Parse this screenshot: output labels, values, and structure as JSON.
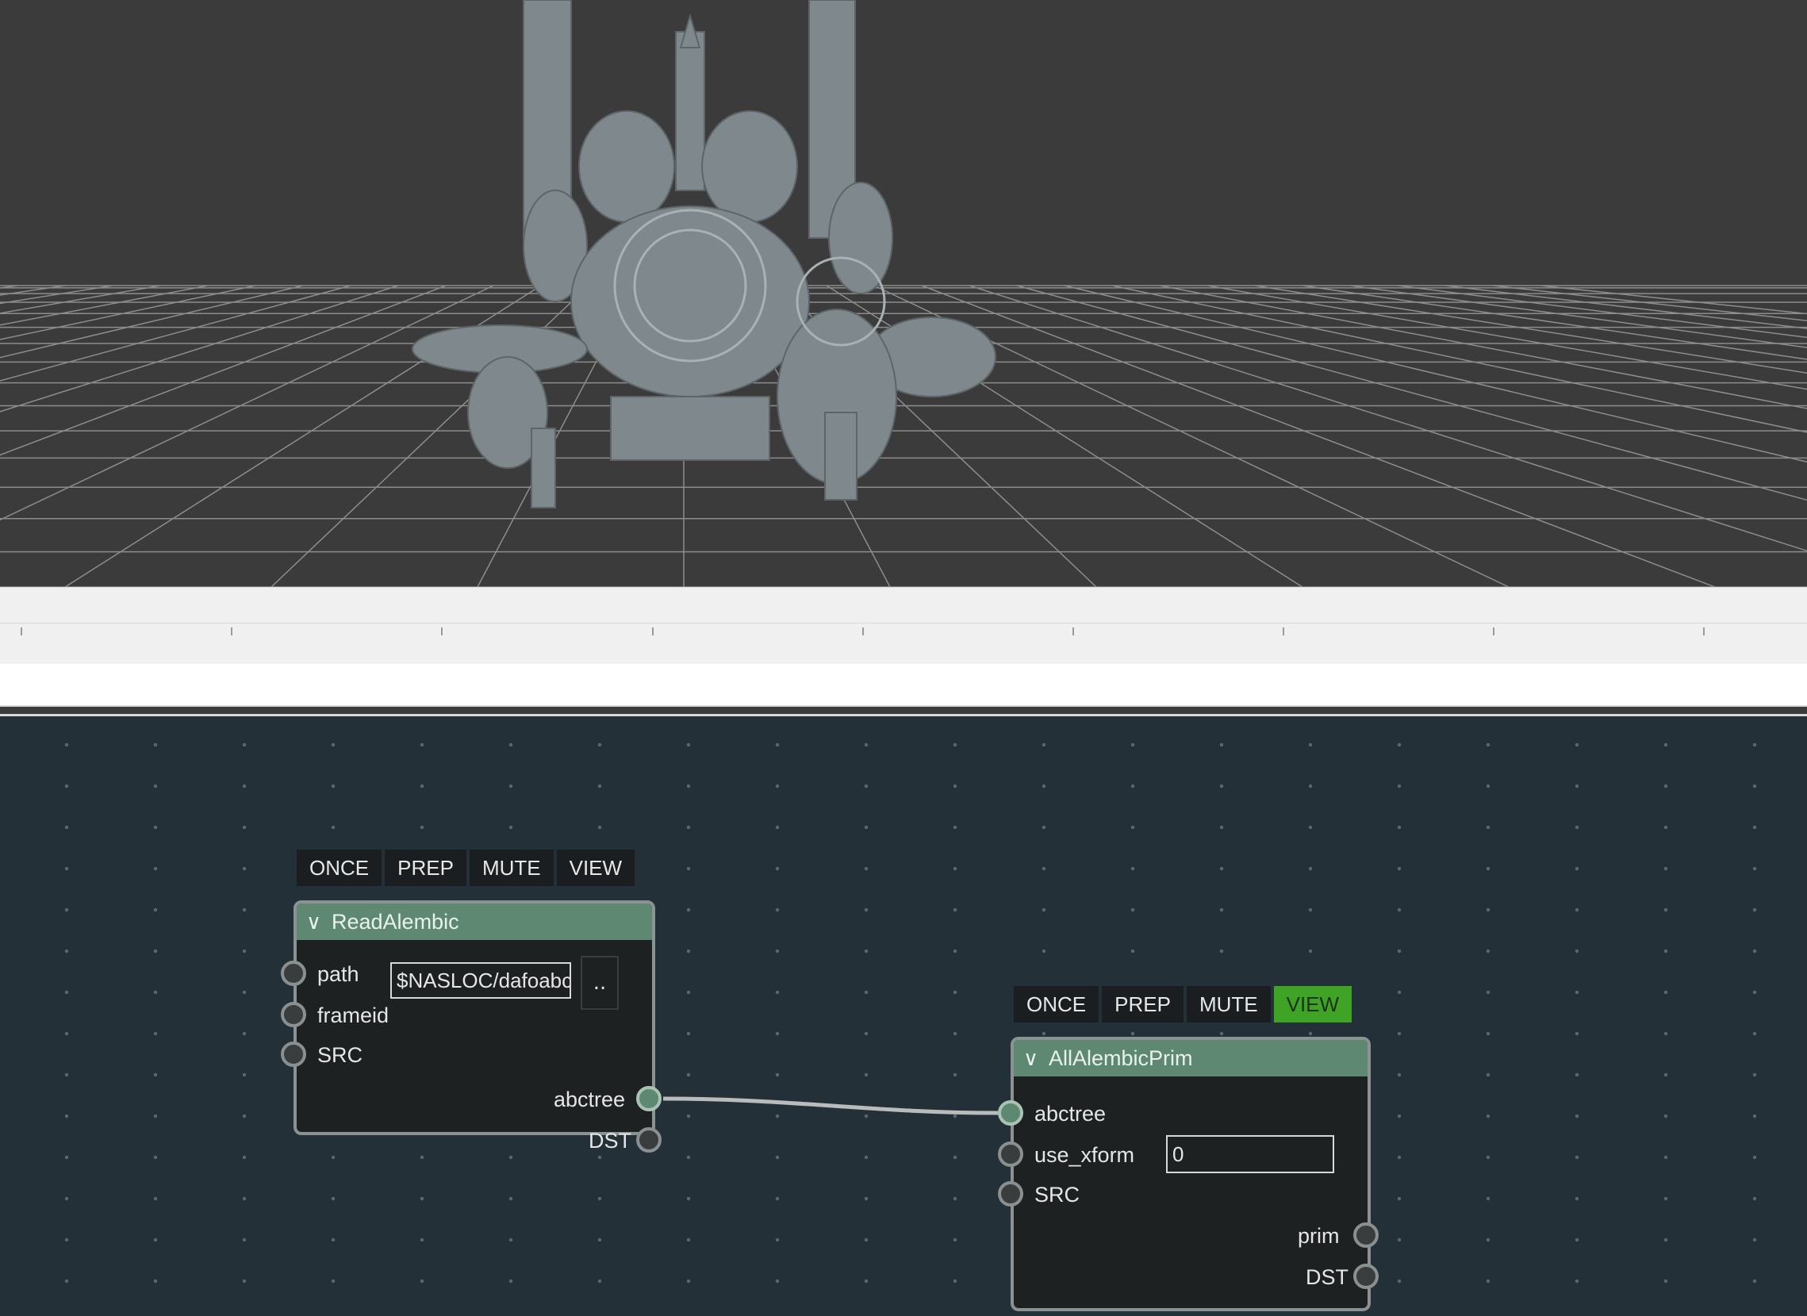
{
  "viewport": {
    "background": "#3b3b3b",
    "grid_color": "#8d8d8d",
    "model_color": "#8a9498"
  },
  "timeline": {},
  "nodes": [
    {
      "title": "ReadAlembic",
      "toolbar": [
        "ONCE",
        "PREP",
        "MUTE",
        "VIEW"
      ],
      "view_active": false,
      "inputs": [
        "path",
        "frameid",
        "SRC"
      ],
      "outputs": [
        "abctree",
        "DST"
      ],
      "path_value": "$NASLOC/dafoabc",
      "browse_label": ".."
    },
    {
      "title": "AllAlembicPrim",
      "toolbar": [
        "ONCE",
        "PREP",
        "MUTE",
        "VIEW"
      ],
      "view_active": true,
      "inputs": [
        "abctree",
        "use_xform",
        "SRC"
      ],
      "outputs": [
        "prim",
        "DST"
      ],
      "use_xform_value": "0"
    }
  ],
  "colors": {
    "graph_bg": "#243038",
    "node_header": "#5f8873",
    "view_on": "#3fa426",
    "link": "#b8bcbc",
    "annotation": "#e03030"
  }
}
